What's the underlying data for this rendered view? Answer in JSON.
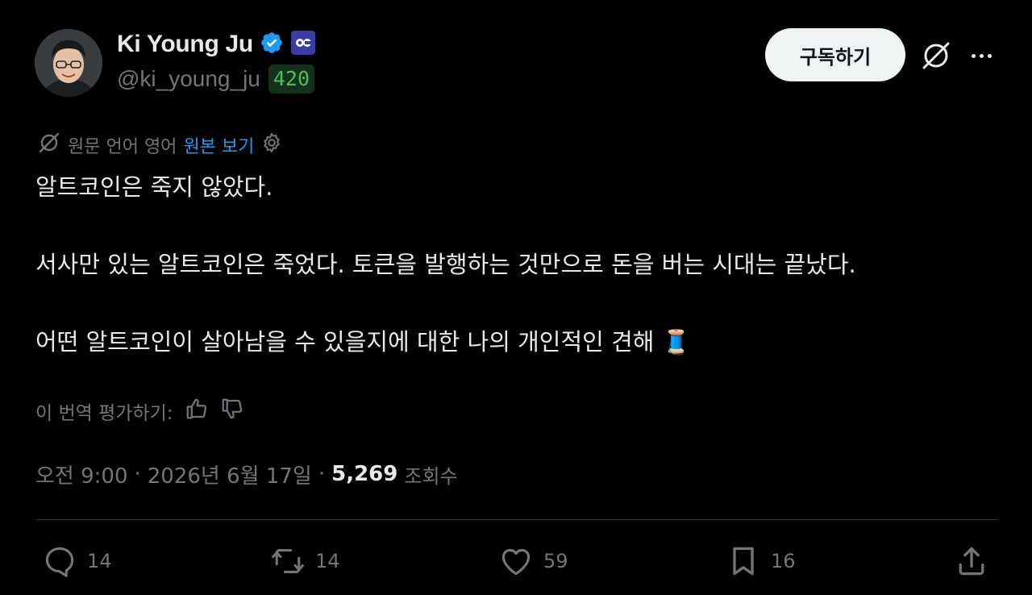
{
  "author": {
    "name": "Ki Young Ju",
    "handle": "@ki_young_ju",
    "score": "420"
  },
  "header": {
    "subscribe_label": "구독하기"
  },
  "translation": {
    "original_language_text": "원문 언어 영어",
    "view_original_label": "원본 보기"
  },
  "tweet": {
    "line1": "알트코인은 죽지 않았다.",
    "line2": "서사만 있는 알트코인은 죽었다. 토큰을 발행하는 것만으로 돈을 버는 시대는 끝났다.",
    "line3": "어떤 알트코인이 살아남을 수 있을지에 대한 나의 개인적인 견해",
    "line3_emoji": "🧵"
  },
  "rate_translation": {
    "label": "이 번역 평가하기:"
  },
  "meta": {
    "time": "오전 9:00",
    "separator": "·",
    "date": "2026년 6월 17일",
    "views_count": "5,269",
    "views_label": "조회수"
  },
  "actions": {
    "replies": "14",
    "reposts": "14",
    "likes": "59",
    "bookmarks": "16"
  },
  "colors": {
    "background": "#000000",
    "text": "#e7e9ea",
    "muted": "#71767b",
    "link": "#1d9bf0",
    "verified": "#1d9bf0",
    "score_green": "#4ac05a",
    "button_bg": "#eff3f4"
  },
  "icons": {
    "verified": "verified-badge-icon",
    "affiliate": "affiliate-badge-icon",
    "grok": "grok-icon",
    "more": "more-icon",
    "settings": "gear-icon",
    "thumbs_up": "thumbs-up-icon",
    "thumbs_down": "thumbs-down-icon",
    "reply": "reply-icon",
    "repost": "repost-icon",
    "like": "heart-icon",
    "bookmark": "bookmark-icon",
    "share": "share-icon"
  }
}
